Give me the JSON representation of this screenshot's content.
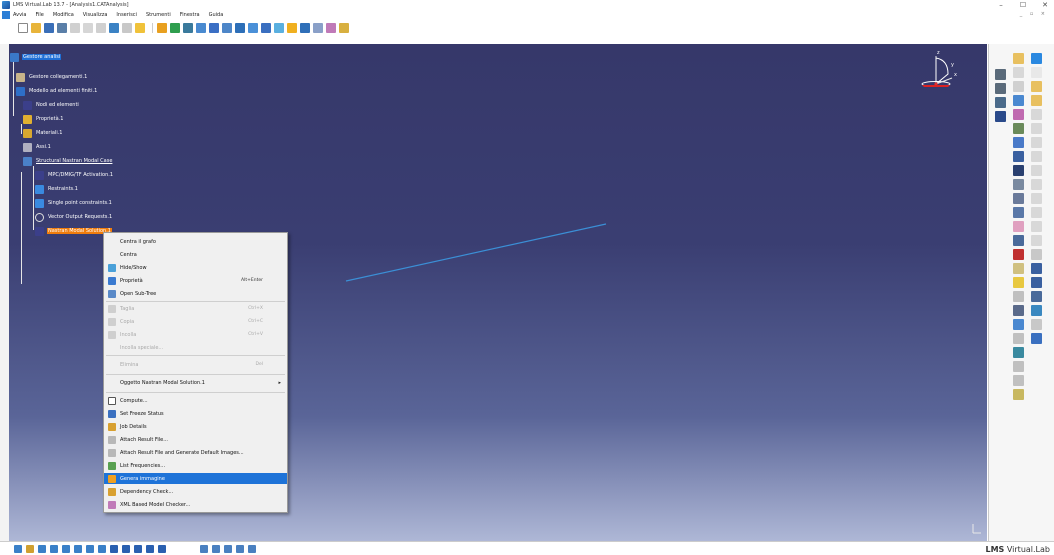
{
  "window": {
    "title": "LMS Virtual.Lab 13.7 - [Analysis1.CATAnalysis]",
    "controls": [
      "–",
      "☐",
      "✕"
    ],
    "doc_controls": "_ ▫ ×"
  },
  "menu": {
    "items": [
      "Avvia",
      "File",
      "Modifica",
      "Visualizza",
      "Inserisci",
      "Strumenti",
      "Finestra",
      "Guida"
    ]
  },
  "tree": {
    "nodes": [
      {
        "label": "Gestore analisi",
        "style": "highlight"
      },
      {
        "label": "Gestore collegamenti.1",
        "style": ""
      },
      {
        "label": "Modello ad elementi finiti.1",
        "style": ""
      },
      {
        "label": "Nodi ed elementi",
        "style": ""
      },
      {
        "label": "Proprietà.1",
        "style": ""
      },
      {
        "label": "Materiali.1",
        "style": ""
      },
      {
        "label": "Assi.1",
        "style": ""
      },
      {
        "label": "Structural Nastran Modal Case",
        "style": "underline"
      },
      {
        "label": "MPC/DMIG/TF Activation.1",
        "style": ""
      },
      {
        "label": "Restraints.1",
        "style": ""
      },
      {
        "label": "Single point constraints.1",
        "style": ""
      },
      {
        "label": "Vector Output Requests.1",
        "style": ""
      },
      {
        "label": "Nastran Modal Solution.1",
        "style": "orange"
      }
    ]
  },
  "compass": {
    "x_label": "x",
    "y_label": "y",
    "z_label": "z"
  },
  "context_menu": {
    "items": [
      {
        "label": "Centra il grafo",
        "shortcut": "",
        "disabled": false,
        "icon": "",
        "selected": false
      },
      {
        "label": "Centra",
        "shortcut": "",
        "disabled": false,
        "icon": "",
        "selected": false
      },
      {
        "label": "Hide/Show",
        "shortcut": "",
        "disabled": false,
        "icon": "hide-show-icon",
        "selected": false
      },
      {
        "label": "Proprietà",
        "shortcut": "Alt+Enter",
        "disabled": false,
        "icon": "properties-icon",
        "selected": false
      },
      {
        "label": "Open Sub-Tree",
        "shortcut": "",
        "disabled": false,
        "icon": "subtree-icon",
        "selected": false
      },
      {
        "label": "Taglia",
        "shortcut": "Ctrl+X",
        "disabled": true,
        "icon": "cut-icon",
        "selected": false
      },
      {
        "label": "Copia",
        "shortcut": "Ctrl+C",
        "disabled": true,
        "icon": "copy-icon",
        "selected": false
      },
      {
        "label": "Incolla",
        "shortcut": "Ctrl+V",
        "disabled": true,
        "icon": "paste-icon",
        "selected": false
      },
      {
        "label": "Incolla speciale...",
        "shortcut": "",
        "disabled": true,
        "icon": "",
        "selected": false
      },
      {
        "label": "Elimina",
        "shortcut": "Del",
        "disabled": true,
        "icon": "",
        "selected": false
      },
      {
        "label": "Oggetto Nastran Modal Solution.1",
        "shortcut": "",
        "disabled": false,
        "icon": "",
        "selected": false,
        "submenu": true
      },
      {
        "label": "Compute...",
        "shortcut": "",
        "disabled": false,
        "icon": "compute-icon",
        "selected": false
      },
      {
        "label": "Set Freeze Status",
        "shortcut": "",
        "disabled": false,
        "icon": "freeze-icon",
        "selected": false
      },
      {
        "label": "Job Details",
        "shortcut": "",
        "disabled": false,
        "icon": "job-details-icon",
        "selected": false
      },
      {
        "label": "Attach Result File...",
        "shortcut": "",
        "disabled": false,
        "icon": "attach-icon",
        "selected": false
      },
      {
        "label": "Attach Result File and Generate Default Images...",
        "shortcut": "",
        "disabled": false,
        "icon": "attach-generate-icon",
        "selected": false
      },
      {
        "label": "List Frequencies...",
        "shortcut": "",
        "disabled": false,
        "icon": "frequencies-icon",
        "selected": false
      },
      {
        "label": "Genera immagine",
        "shortcut": "",
        "disabled": false,
        "icon": "generate-image-icon",
        "selected": true
      },
      {
        "label": "Dependency Check...",
        "shortcut": "",
        "disabled": false,
        "icon": "dependency-icon",
        "selected": false
      },
      {
        "label": "XML Based Model Checker...",
        "shortcut": "",
        "disabled": false,
        "icon": "xml-checker-icon",
        "selected": false
      }
    ]
  },
  "brand": {
    "bold": "LMS",
    "rest": " Virtual.Lab"
  },
  "colors": {
    "viewport_top": "#36386a",
    "viewport_bottom": "#aeb7d6",
    "selection": "#1e73d8",
    "tree_highlight": "#1f6fd6",
    "tree_active": "#f07d0c",
    "geometry_line": "#3b8fd6"
  }
}
